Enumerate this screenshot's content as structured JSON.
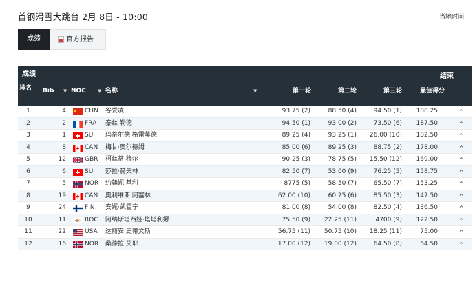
{
  "header": {
    "title": "首钢滑雪大跳台 2月 8日 - 10:00",
    "local_time_label": "当地时间"
  },
  "tabs": [
    {
      "label": "成绩",
      "active": true
    },
    {
      "label": "官方报告",
      "active": false,
      "icon": "pdf-icon"
    }
  ],
  "panel": {
    "label": "成绩",
    "status": "结束",
    "columns": {
      "rank": "排名",
      "bib": "Bib",
      "sort_icon": "▼",
      "noc": "NOC",
      "name": "名称",
      "run1": "第一轮",
      "run2": "第二轮",
      "run3": "第三轮",
      "best": "最佳得分"
    }
  },
  "expand_icon": "^",
  "rows": [
    {
      "rank": "1",
      "bib": "4",
      "noc": "CHN",
      "name": "谷爱凌",
      "run1": "93.75 (2)",
      "run2": "88.50 (4)",
      "run3": "94.50 (1)",
      "best": "188.25"
    },
    {
      "rank": "2",
      "bib": "2",
      "noc": "FRA",
      "name": "泰丝 勒德",
      "run1": "94.50 (1)",
      "run2": "93.00 (2)",
      "run3": "73.50 (6)",
      "best": "187.50"
    },
    {
      "rank": "3",
      "bib": "1",
      "noc": "SUI",
      "name": "玛蒂尔德·格雷莫德",
      "run1": "89.25 (4)",
      "run2": "93.25 (1)",
      "run3": "26.00 (10)",
      "best": "182.50"
    },
    {
      "rank": "4",
      "bib": "8",
      "noc": "CAN",
      "name": "梅甘·奥尔德姆",
      "run1": "85.00 (6)",
      "run2": "89.25 (3)",
      "run3": "88.75 (2)",
      "best": "178.00"
    },
    {
      "rank": "5",
      "bib": "12",
      "noc": "GBR",
      "name": "柯丝蒂·穆尔",
      "run1": "90.25 (3)",
      "run2": "78.75 (5)",
      "run3": "15.50 (12)",
      "best": "169.00"
    },
    {
      "rank": "6",
      "bib": "6",
      "noc": "SUI",
      "name": "莎拉·赫夫林",
      "run1": "82.50 (7)",
      "run2": "53.00 (9)",
      "run3": "76.25 (5)",
      "best": "158.75"
    },
    {
      "rank": "7",
      "bib": "5",
      "noc": "NOR",
      "name": "约翰妮·基利",
      "run1": "8775 (5)",
      "run2": "58.50 (7)",
      "run3": "65.50 (7)",
      "best": "153.25"
    },
    {
      "rank": "8",
      "bib": "19",
      "noc": "CAN",
      "name": "奥利维亚·阿塞林",
      "run1": "62.00 (10)",
      "run2": "60.25 (6)",
      "run3": "85.50 (3)",
      "best": "147.50"
    },
    {
      "rank": "9",
      "bib": "24",
      "noc": "FIN",
      "name": "安妮·凯霍宁",
      "run1": "81.00 (8)",
      "run2": "54.00 (8)",
      "run3": "82.50 (4)",
      "best": "136.50"
    },
    {
      "rank": "10",
      "bib": "11",
      "noc": "ROC",
      "name": "阿纳斯塔西娅·塔塔利娜",
      "run1": "75.50 (9)",
      "run2": "22.25 (11)",
      "run3": "4700 (9)",
      "best": "122.50"
    },
    {
      "rank": "11",
      "bib": "22",
      "noc": "USA",
      "name": "达丽安·史蒂文斯",
      "run1": "56.75 (11)",
      "run2": "50.75 (10)",
      "run3": "18.25 (11)",
      "best": "75.00"
    },
    {
      "rank": "12",
      "bib": "16",
      "noc": "NOR",
      "name": "桑德拉·艾耶",
      "run1": "17.00 (12)",
      "run2": "19.00 (12)",
      "run3": "64.50 (8)",
      "best": "64.50"
    }
  ]
}
